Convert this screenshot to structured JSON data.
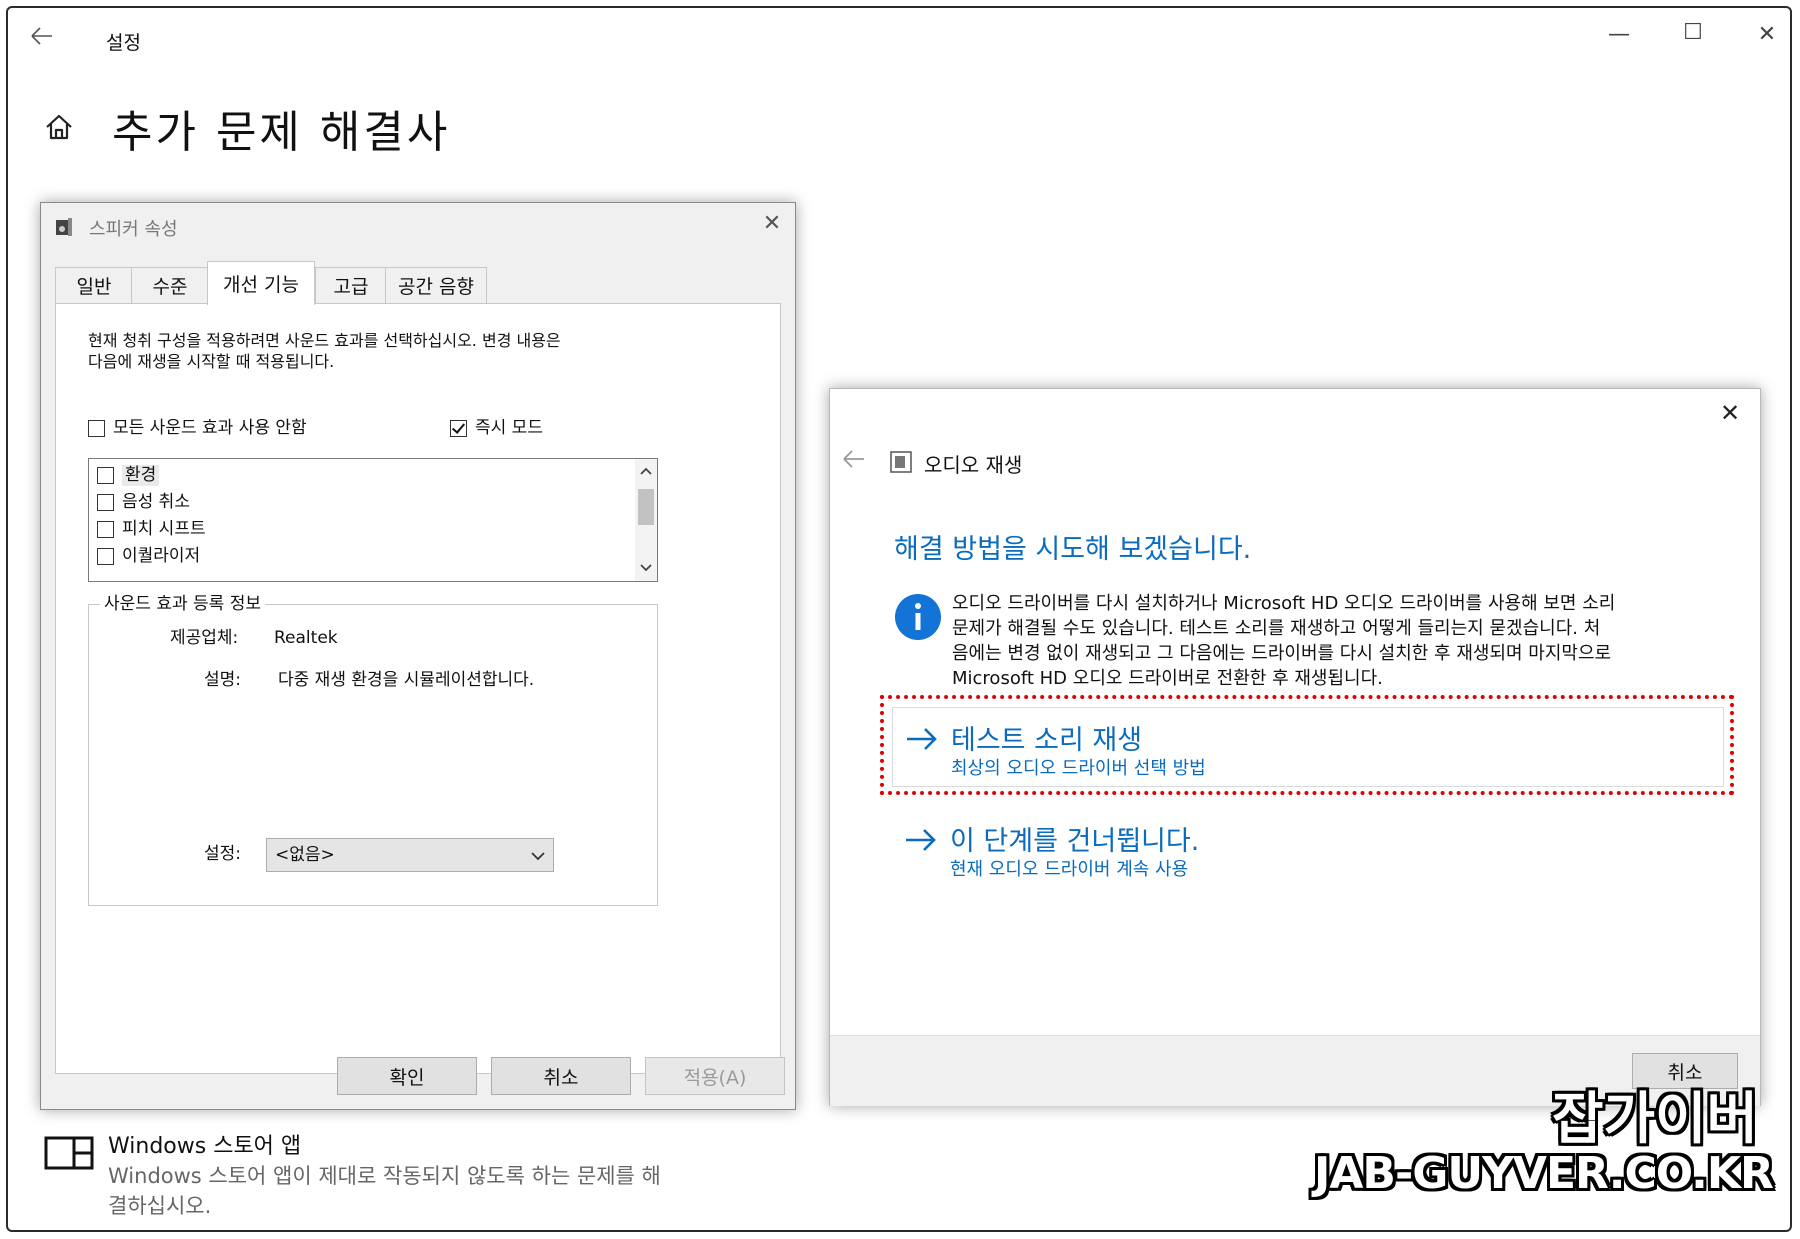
{
  "window": {
    "title": "설정",
    "back_icon": "back-arrow-icon",
    "minimize": "—",
    "maximize": "☐",
    "close": "✕"
  },
  "page": {
    "home_icon": "home-icon",
    "title": "추가 문제 해결사"
  },
  "speaker_dialog": {
    "title": "스피커 속성",
    "close": "✕",
    "tabs": [
      "일반",
      "수준",
      "개선 기능",
      "고급",
      "공간 음향"
    ],
    "active_tab": "개선 기능",
    "description_line1": "현재 청취 구성을 적용하려면 사운드 효과를 선택하십시오. 변경 내용은",
    "description_line2": "다음에 재생을 시작할 때 적용됩니다.",
    "disable_all_label": "모든 사운드 효과 사용 안함",
    "immediate_mode_label": "즉시 모드",
    "effects": [
      "환경",
      "음성 취소",
      "피치 시프트",
      "이퀄라이저"
    ],
    "group_title": "사운드 효과 등록 정보",
    "provider_label": "제공업체:",
    "provider_value": "Realtek",
    "desc_label": "설명:",
    "desc_value": "다중 재생 환경을 시뮬레이션합니다.",
    "setting_label": "설정:",
    "setting_value": "<없음>",
    "ok": "확인",
    "cancel": "취소",
    "apply": "적용(A)"
  },
  "troubleshooter": {
    "close": "✕",
    "back_icon": "back-arrow-icon",
    "title": "오디오 재생",
    "heading": "해결 방법을 시도해 보겠습니다.",
    "info_lines": [
      "오디오 드라이버를 다시 설치하거나 Microsoft HD 오디오 드라이버를 사용해 보면 소리",
      "문제가 해결될 수도 있습니다. 테스트 소리를 재생하고 어떻게 들리는지 묻겠습니다. 처",
      "음에는 변경 없이 재생되고 그 다음에는 드라이버를 다시 설치한 후 재생되며 마지막으로",
      "Microsoft HD 오디오 드라이버로 전환한 후 재생됩니다."
    ],
    "option1_title": "테스트 소리 재생",
    "option1_sub": "최상의 오디오 드라이버 선택 방법",
    "option2_title": "이 단계를 건너뜁니다.",
    "option2_sub": "현재 오디오 드라이버 계속 사용",
    "cancel": "취소"
  },
  "store_item": {
    "title": "Windows 스토어 앱",
    "desc_line1": "Windows 스토어 앱이 제대로 작동되지 않도록 하는 문제를 해",
    "desc_line2": "결하십시오."
  },
  "watermark": {
    "line1": "잡가이버",
    "line2": "JAB-GUYVER.CO.KR"
  },
  "colors": {
    "accent": "#0a6bbf",
    "highlight_border": "#e00000",
    "dialog_bg": "#f0f0f0"
  }
}
